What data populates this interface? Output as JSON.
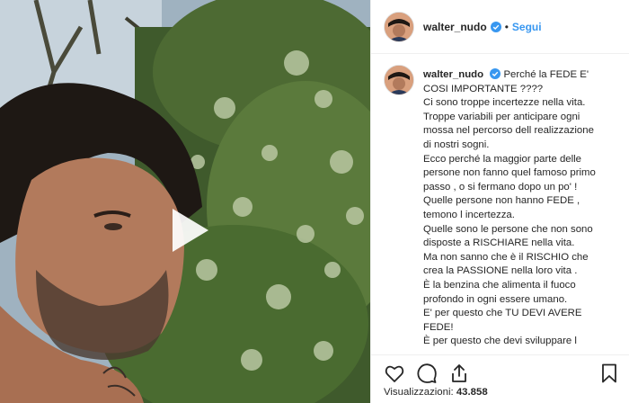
{
  "post": {
    "username": "walter_nudo",
    "separator": "•",
    "follow_label": "Segui",
    "caption_title": "Perché la FEDE E' COSI IMPORTANTE ????",
    "caption_lines": [
      "Ci sono troppe incertezze nella vita.",
      "Troppe variabili per anticipare ogni",
      "mossa nel percorso dell realizzazione",
      "di nostri sogni.",
      "Ecco perché la maggior parte delle",
      "persone non fanno quel famoso primo",
      "passo , o si fermano dopo un po' !",
      "Quelle persone non hanno FEDE ,",
      "temono l incertezza.",
      "Quelle sono le persone che non sono",
      "disposte a RISCHIARE nella vita.",
      "Ma non sanno che è il RISCHIO che",
      "crea la PASSIONE nella loro vita .",
      "È la benzina che alimenta il fuoco",
      "profondo in ogni essere umano.",
      "E' per questo che TU DEVI AVERE",
      "FEDE!",
      "È per questo che devi sviluppare l"
    ],
    "views_label": "Visualizzazioni:",
    "views_count": "43.858"
  },
  "icons": {
    "like": "heart-icon",
    "comment": "comment-icon",
    "share": "share-icon",
    "save": "bookmark-icon",
    "play": "play-icon",
    "verified": "verified-badge-icon"
  },
  "colors": {
    "accent": "#3897f0",
    "verified": "#3897f0",
    "text": "#262626"
  }
}
